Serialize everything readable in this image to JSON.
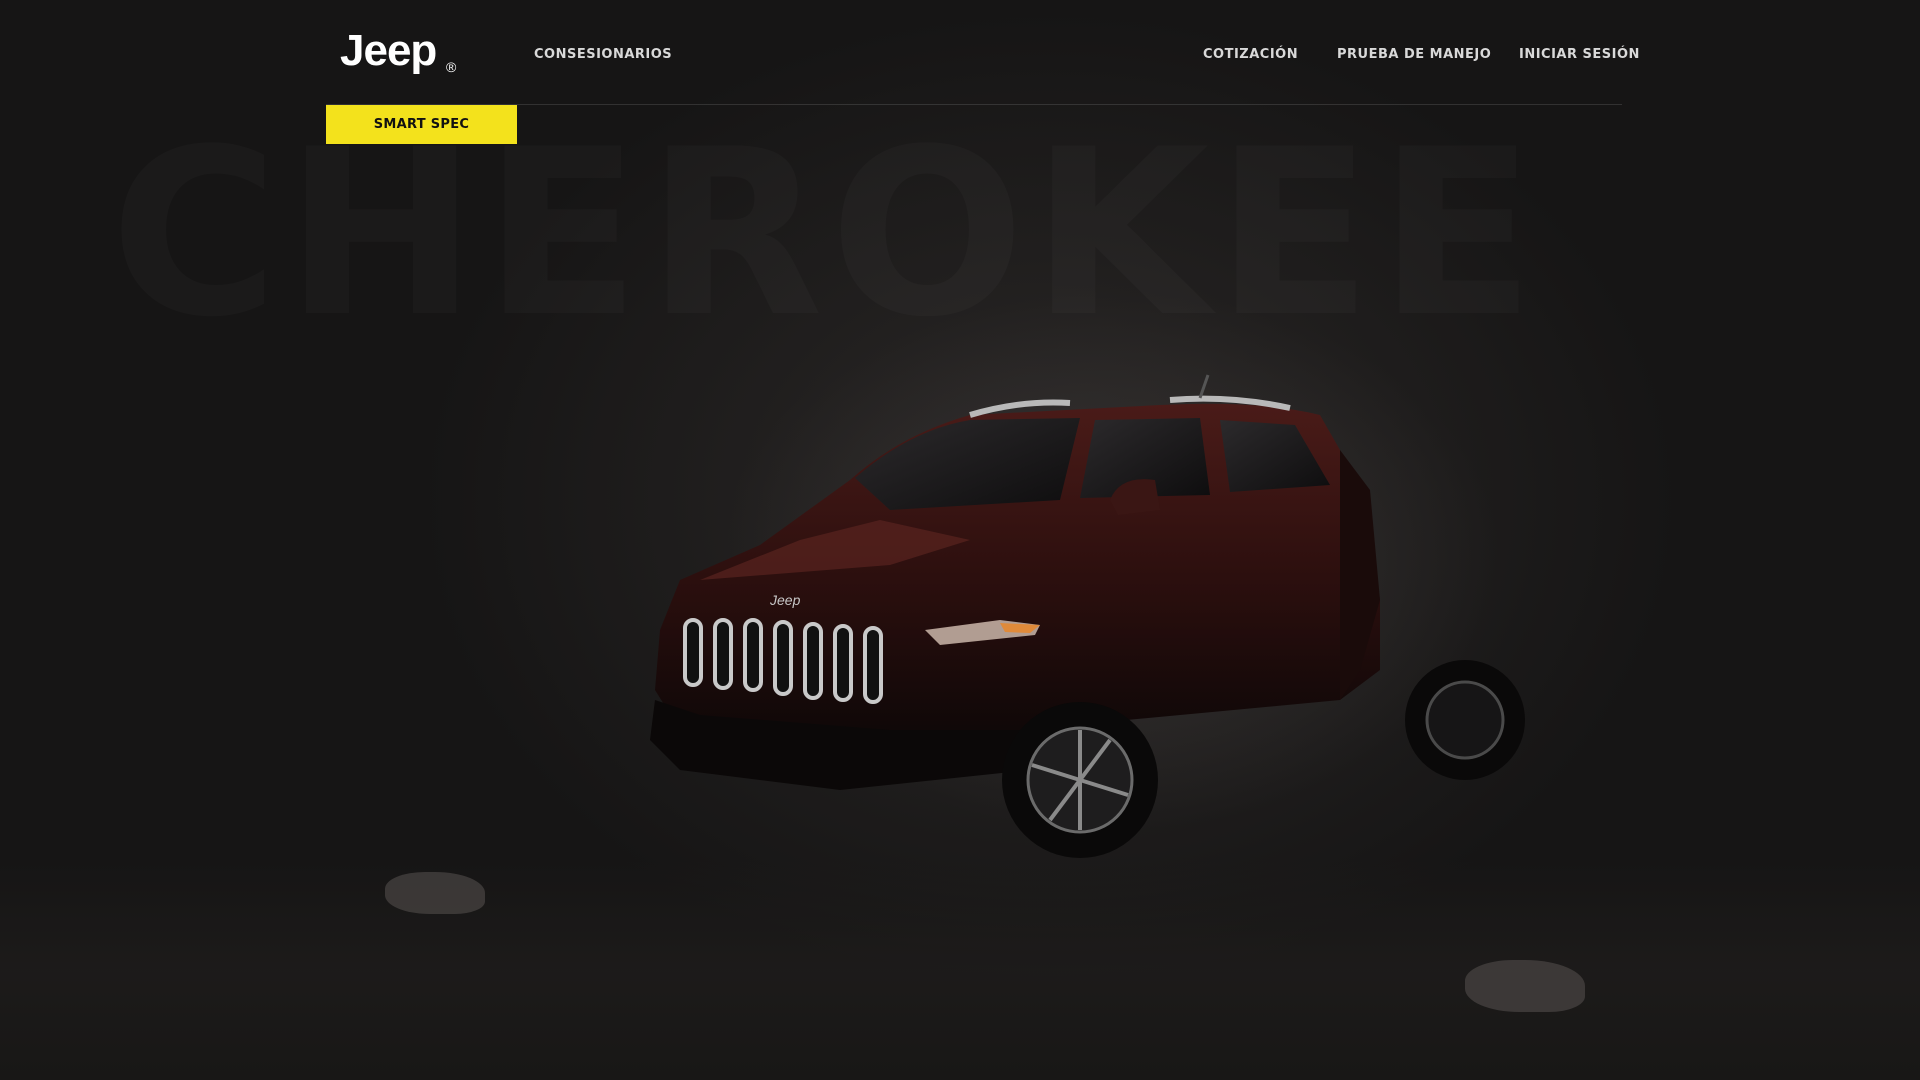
{
  "brand": {
    "logo_text": "Jeep",
    "registered_mark": "®"
  },
  "nav": {
    "left": [
      {
        "label": "CONSESIONARIOS"
      }
    ],
    "right": [
      {
        "label": "COTIZACIÓN"
      },
      {
        "label": "PRUEBA DE MANEJO"
      },
      {
        "label": "INICIAR SESIÓN"
      }
    ]
  },
  "cta": {
    "smart_spec_label": "SMART SPEC",
    "color": "#f3e21c"
  },
  "hero": {
    "background_word": "CHEROKEE",
    "vehicle_badge": "Jeep",
    "vehicle_color": "#3a1614"
  }
}
